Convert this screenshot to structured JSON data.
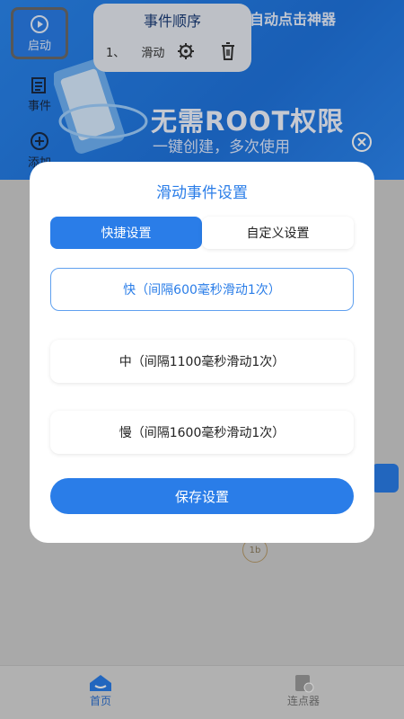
{
  "app": {
    "title": "自动点击神器",
    "banner_heading": "无需ROOT权限",
    "banner_sub": "一键创建，多次使用"
  },
  "side_panel": {
    "start_label": "启动",
    "event_label": "事件",
    "add_label": "添加"
  },
  "event_order": {
    "title": "事件顺序",
    "row_index": "1、",
    "row_label": "滑动"
  },
  "floating": {
    "target_label": "1b"
  },
  "bottom_nav": {
    "home_label": "首页",
    "clicker_label": "连点器"
  },
  "dialog": {
    "title": "滑动事件设置",
    "tabs": [
      {
        "label": "快捷设置",
        "active": true
      },
      {
        "label": "自定义设置",
        "active": false
      }
    ],
    "options": [
      {
        "label": "快（间隔600毫秒滑动1次）",
        "selected": true
      },
      {
        "label": "中（间隔1100毫秒滑动1次）",
        "selected": false
      },
      {
        "label": "慢（间隔1600毫秒滑动1次）",
        "selected": false
      }
    ],
    "save_label": "保存设置"
  },
  "colors": {
    "accent": "#2a7de8",
    "banner": "#1f74de",
    "dialog_bg": "#ffffff"
  }
}
